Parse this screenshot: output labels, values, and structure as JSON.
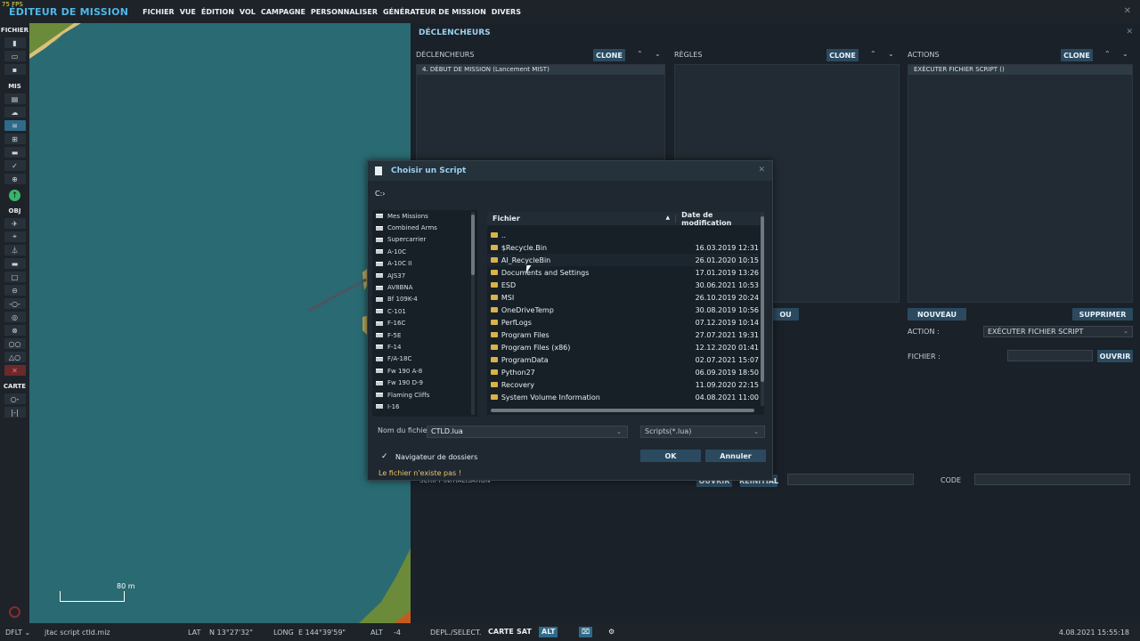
{
  "fps": "75 FPS",
  "app_title": "ÉDITEUR DE MISSION",
  "menus": [
    "FICHIER",
    "VUE",
    "ÉDITION",
    "VOL",
    "CAMPAGNE",
    "PERSONNALISER",
    "GÉNÉRATEUR DE MISSION",
    "DIVERS"
  ],
  "toolbar": {
    "sections": [
      "FICHIER",
      "MIS",
      "OBJ",
      "CARTE"
    ]
  },
  "map": {
    "scale_label": "80 m",
    "colors": {
      "water": "#2a6a72",
      "land": "#6b8a3a",
      "shore": "#d8c27a"
    }
  },
  "triggers": {
    "title": "DÉCLENCHEURS",
    "col_triggers": "DÉCLENCHEURS",
    "col_rules": "RÈGLES",
    "col_actions": "ACTIONS",
    "clone": "CLONE",
    "trigger_item": "4. DÉBUT DE MISSION (Lancement MIST)",
    "action_item": "EXÉCUTER FICHIER SCRIPT ()",
    "ou": "OU",
    "nouveau": "NOUVEAU",
    "supprimer": "SUPPRIMER",
    "action_label": "ACTION :",
    "action_value": "EXÉCUTER FICHIER SCRIPT",
    "fichier_label": "FICHIER :",
    "ouvrir": "OUVRIR",
    "script_init": "SCRIPT INITIALISATION",
    "reinitial": "RÉINITIAL",
    "code_label": "CODE"
  },
  "dialog": {
    "title": "Choisir un Script",
    "path": "C:›",
    "folders": [
      "Mes Missions",
      "Combined Arms",
      "Supercarrier",
      "A-10C",
      "A-10C II",
      "AJS37",
      "AV8BNA",
      "Bf 109K-4",
      "C-101",
      "F-16C",
      "F-5E",
      "F-14",
      "F/A-18C",
      "Fw 190 A-8",
      "Fw 190 D-9",
      "Flaming Cliffs",
      "I-16"
    ],
    "col_file": "Fichier",
    "col_date": "Date de modification",
    "files": [
      {
        "name": "..",
        "date": ""
      },
      {
        "name": "$Recycle.Bin",
        "date": "16.03.2019 12:31"
      },
      {
        "name": "AI_RecycleBin",
        "date": "26.01.2020 10:15"
      },
      {
        "name": "Documents and Settings",
        "date": "17.01.2019 13:26"
      },
      {
        "name": "ESD",
        "date": "30.06.2021 10:53"
      },
      {
        "name": "MSI",
        "date": "26.10.2019 20:24"
      },
      {
        "name": "OneDriveTemp",
        "date": "30.08.2019 10:56"
      },
      {
        "name": "PerfLogs",
        "date": "07.12.2019 10:14"
      },
      {
        "name": "Program Files",
        "date": "27.07.2021 19:31"
      },
      {
        "name": "Program Files (x86)",
        "date": "12.12.2020 01:41"
      },
      {
        "name": "ProgramData",
        "date": "02.07.2021 15:07"
      },
      {
        "name": "Python27",
        "date": "06.09.2019 18:50"
      },
      {
        "name": "Recovery",
        "date": "11.09.2020 22:15"
      },
      {
        "name": "System Volume Information",
        "date": "04.08.2021 11:00"
      }
    ],
    "filename_label": "Nom du fichier",
    "filename_value": "CTLD.lua",
    "filter_value": "Scripts(*.lua)",
    "folder_nav_label": "Navigateur de dossiers",
    "folder_nav_checked": true,
    "warning": "Le fichier n'existe pas !",
    "ok": "OK",
    "cancel": "Annuler"
  },
  "status": {
    "mode": "DFLT",
    "mission": "jtac script ctld.miz",
    "lat_label": "LAT",
    "lat_value": "N 13°27'32\"",
    "long_label": "LONG",
    "long_value": "E 144°39'59\"",
    "alt_label": "ALT",
    "alt_value": "-4",
    "depl": "DEPL./SELECT.",
    "carte": "CARTE",
    "sat": "SAT",
    "alt_btn": "ALT",
    "datetime": "4.08.2021 15:55:18"
  }
}
